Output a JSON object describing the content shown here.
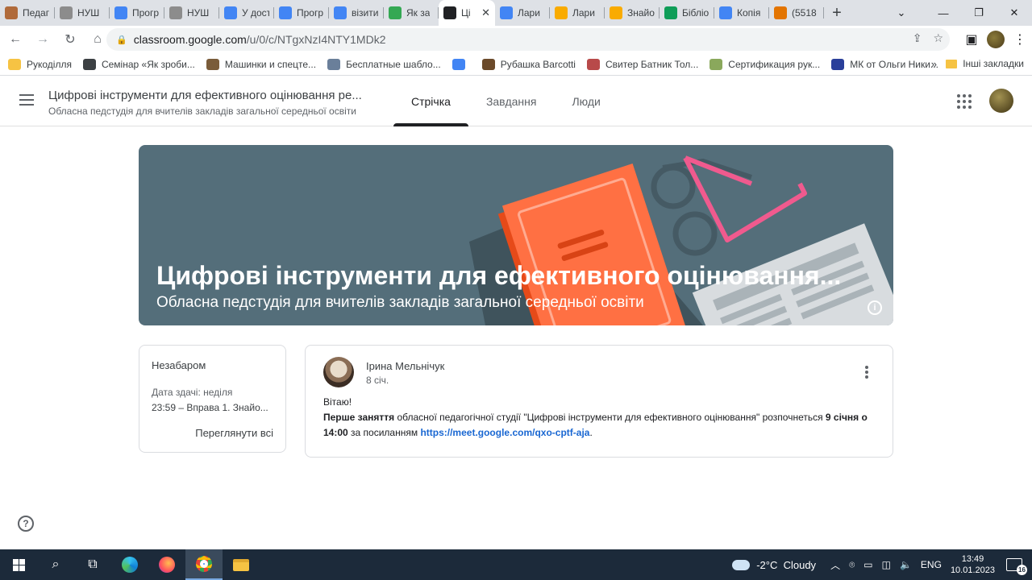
{
  "browser": {
    "tabs": [
      {
        "label": "Педаг",
        "color": "#b06a3a"
      },
      {
        "label": "НУШ",
        "color": "#8c8c8c"
      },
      {
        "label": "Прогр",
        "color": "#4285f4"
      },
      {
        "label": "НУШ",
        "color": "#8c8c8c"
      },
      {
        "label": "У дост",
        "color": "#4285f4"
      },
      {
        "label": "Прогр",
        "color": "#4285f4"
      },
      {
        "label": "візити",
        "color": "#4285f4"
      },
      {
        "label": "Як за",
        "color": "#34a853"
      },
      {
        "label": "Ці",
        "color": "#202124",
        "active": true
      },
      {
        "label": "Лари",
        "color": "#4285f4"
      },
      {
        "label": "Лари",
        "color": "#f9ab00"
      },
      {
        "label": "Знайо",
        "color": "#f9ab00"
      },
      {
        "label": "Бібліо",
        "color": "#0f9d58"
      },
      {
        "label": "Копія",
        "color": "#4285f4"
      },
      {
        "label": "(5518",
        "color": "#e37400"
      }
    ],
    "url_host": "classroom.google.com",
    "url_path": "/u/0/c/NTgxNzI4NTY1MDk2",
    "bookmarks": [
      {
        "label": "Рукоділля",
        "color": "#f6c343"
      },
      {
        "label": "Семінар «Як зроби...",
        "color": "#3c4043"
      },
      {
        "label": "Машинки и спецте...",
        "color": "#7a5c3a"
      },
      {
        "label": "Бесплатные шабло...",
        "color": "#6a7f9a"
      },
      {
        "label": "",
        "color": "#4285f4"
      },
      {
        "label": "Рубашка Barcotti",
        "color": "#6b4a2a"
      },
      {
        "label": "Свитер Батник Тол...",
        "color": "#b84a4a"
      },
      {
        "label": "Сертификация рук...",
        "color": "#8aa85c"
      },
      {
        "label": "МК от Ольги Ники...",
        "color": "#2a3f9a"
      }
    ],
    "bookmarks_more": "»",
    "bookmarks_other": "Інші закладки"
  },
  "classroom": {
    "course_title": "Цифрові інструменти для ефективного оцінювання ре...",
    "course_subtitle": "Обласна педстудія для вчителів закладів загальної середньої освіти",
    "tabs": [
      "Стрічка",
      "Завдання",
      "Люди"
    ],
    "banner_title": "Цифрові інструменти для ефективного оцінювання...",
    "banner_subtitle": "Обласна педстудія для вчителів закладів загальної середньої освіти",
    "upcoming": {
      "title": "Незабаром",
      "due": "Дата здачі: неділя",
      "item": "23:59 – Вправа 1. Знайо...",
      "view_all": "Переглянути всі"
    },
    "post": {
      "author": "Ірина Мельнічук",
      "date": "8 січ.",
      "greeting": "Вітаю!",
      "bold1": "Перше заняття",
      "text1": " обласної педагогічної студії \"Цифрові інструменти для ефективного оцінювання\" розпочнеться ",
      "bold2": "9 січня о 14:00",
      "text2": " за посиланням ",
      "link": "https://meet.google.com/qxo-cptf-aja",
      "text3": "."
    },
    "help_glyph": "?"
  },
  "taskbar": {
    "weather_temp": "-2°C",
    "weather_text": "Cloudy",
    "lang": "ENG",
    "time": "13:49",
    "date": "10.01.2023",
    "notifications": "16"
  },
  "colors": {
    "banner_bg": "#546e7a",
    "book": "#ff7043",
    "glasses_pink": "#f05a8e",
    "link": "#1967d2"
  }
}
